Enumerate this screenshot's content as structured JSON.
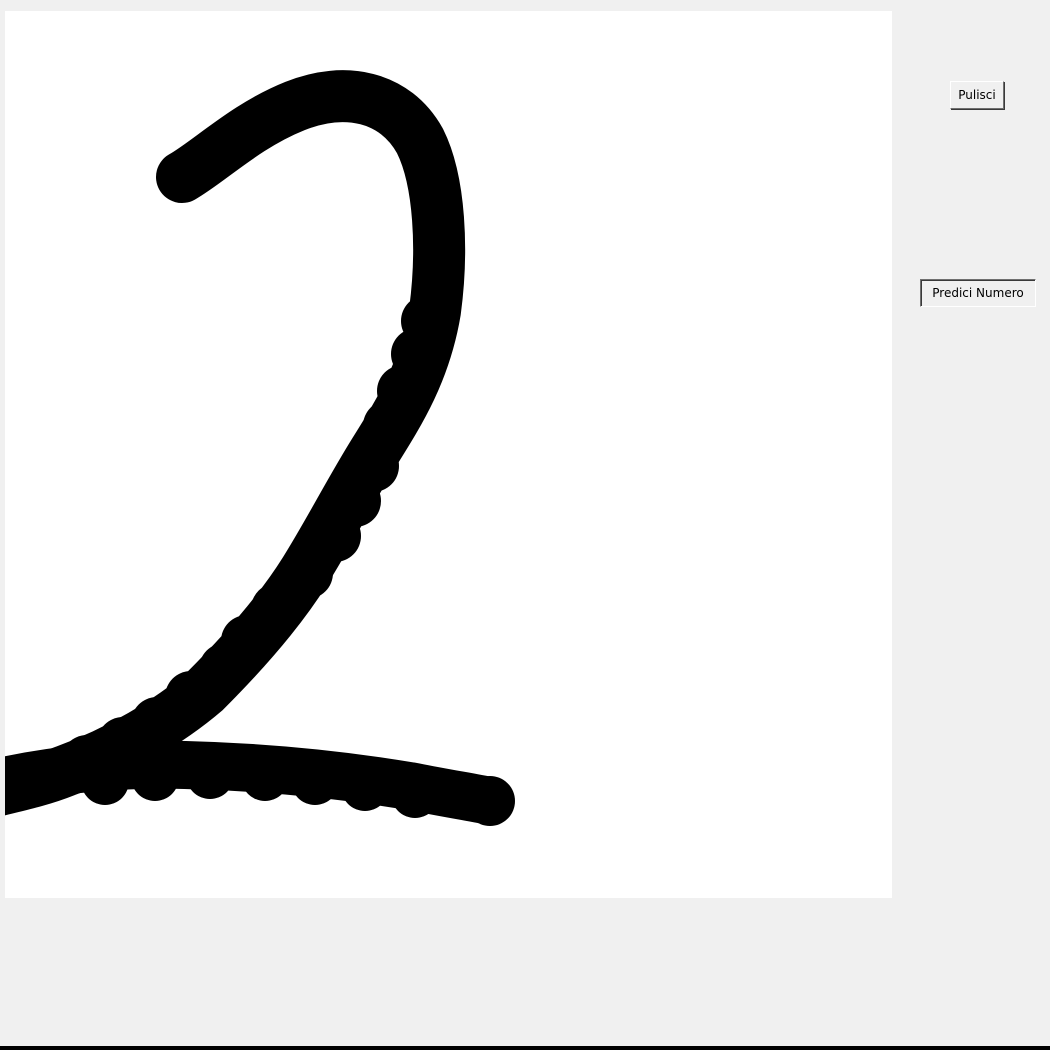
{
  "buttons": {
    "clear_label": "Pulisci",
    "predict_label": "Predici Numero"
  },
  "canvas": {
    "drawn_content": "handwritten-digit",
    "stroke_color": "#000000",
    "background_color": "#ffffff"
  },
  "colors": {
    "window_background": "#f0f0f0"
  }
}
